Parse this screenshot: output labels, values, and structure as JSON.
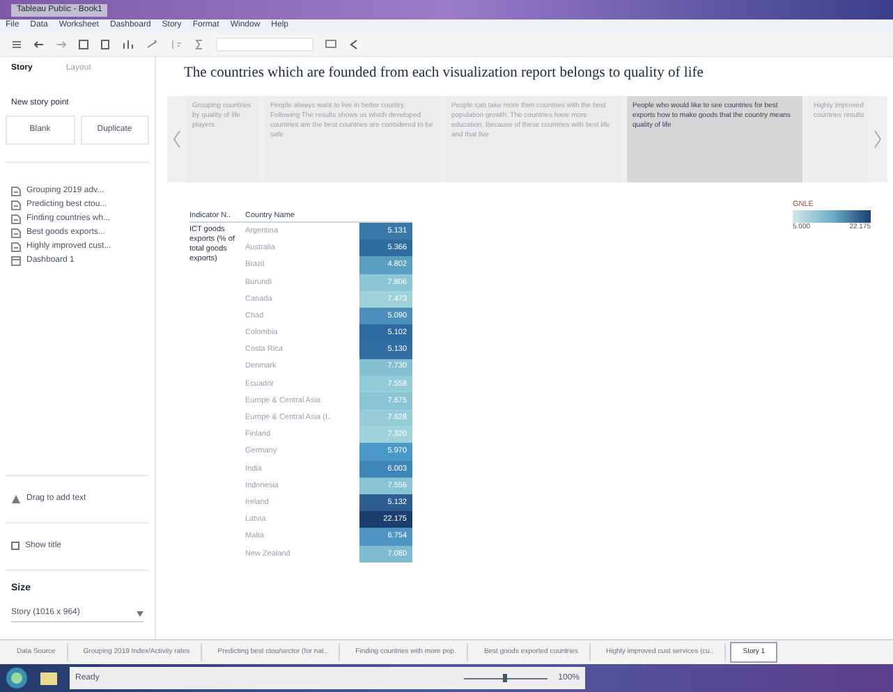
{
  "window": {
    "title": "Tableau Public - Book1"
  },
  "menu": [
    "File",
    "Data",
    "Worksheet",
    "Dashboard",
    "Story",
    "Format",
    "Window",
    "Help"
  ],
  "sidebar": {
    "tabs": [
      {
        "label": "Story",
        "selected": true
      },
      {
        "label": "Layout",
        "selected": false
      }
    ],
    "new_story_point": "New story point",
    "buttons": [
      "Blank",
      "Duplicate"
    ],
    "sheets": [
      {
        "label": "Grouping 2019 adv...",
        "kind": "sheet"
      },
      {
        "label": "Predicting best ctou...",
        "kind": "sheet"
      },
      {
        "label": "Finding countries wh...",
        "kind": "sheet"
      },
      {
        "label": "Best goods exports...",
        "kind": "sheet"
      },
      {
        "label": "Highly improved cust...",
        "kind": "sheet"
      },
      {
        "label": "Dashboard 1",
        "kind": "dashboard"
      }
    ],
    "drag_text": "Drag to add text",
    "show_title": {
      "label": "Show title",
      "checked": false
    },
    "size_label": "Size",
    "size_value": "Story (1016 x 964)"
  },
  "story": {
    "title": "The countries which are founded from each visualization report belongs to quality of life",
    "points": [
      {
        "caption": "Grouping countries by quality of life players",
        "selected": false
      },
      {
        "caption": "People always want to live in better country. Following The results shows us which developed countries are the best countries are considered to be safe",
        "selected": false
      },
      {
        "caption": "People can take more then countries with the best population growth. The countries have more education. Because of these countries with best life and that live",
        "selected": false
      },
      {
        "caption": "People who would like to see countries for best exports how to make goods that the country means quality of life",
        "selected": true
      },
      {
        "caption": "Highly improved countries results",
        "selected": false
      }
    ]
  },
  "table": {
    "columns": [
      "Indicator N..",
      "Country Name"
    ],
    "indicator": "ICT goods exports (% of total goods exports)",
    "rows": [
      {
        "country": "Argentina",
        "value": "5.131",
        "color": "#3a78a8"
      },
      {
        "country": "Australia",
        "value": "5.366",
        "color": "#2f6c9f"
      },
      {
        "country": "Brazil",
        "value": "4.802",
        "color": "#5a9fc0"
      },
      {
        "country": "Burundi",
        "value": "7.806",
        "color": "#8cc6d4"
      },
      {
        "country": "Canada",
        "value": "7.473",
        "color": "#9dd2da"
      },
      {
        "country": "Chad",
        "value": "5.090",
        "color": "#4c8fbb"
      },
      {
        "country": "Colombia",
        "value": "5.102",
        "color": "#2e6aa0"
      },
      {
        "country": "Costa Rica",
        "value": "5.130",
        "color": "#336ea2"
      },
      {
        "country": "Denmark",
        "value": "7.730",
        "color": "#84c0d2"
      },
      {
        "country": "Ecuador",
        "value": "7.558",
        "color": "#93cbd6"
      },
      {
        "country": "Europe & Central Asia",
        "value": "7.675",
        "color": "#8ac4d4"
      },
      {
        "country": "Europe & Central Asia (I..",
        "value": "7.628",
        "color": "#95ccd8"
      },
      {
        "country": "Finland",
        "value": "7.320",
        "color": "#9ed3dc"
      },
      {
        "country": "Germany",
        "value": "5.970",
        "color": "#4a98c8"
      },
      {
        "country": "India",
        "value": "6.003",
        "color": "#3f86b8"
      },
      {
        "country": "Indonesia",
        "value": "7.556",
        "color": "#88c3d4"
      },
      {
        "country": "Ireland",
        "value": "5.132",
        "color": "#2d5f92"
      },
      {
        "country": "Latvia",
        "value": "22.175",
        "color": "#1c3f70"
      },
      {
        "country": "Malta",
        "value": "6.754",
        "color": "#4f95c4"
      },
      {
        "country": "New Zealand",
        "value": "7.080",
        "color": "#7ebbd0"
      }
    ]
  },
  "legend": {
    "title": "GNLE",
    "min": "5.000",
    "max": "22.175"
  },
  "bottom_tabs": [
    {
      "label": "Data Source",
      "selected": false
    },
    {
      "label": "Grouping 2019 Index/Activity rates",
      "selected": false
    },
    {
      "label": "Predicting best ctou/sector (for nat..",
      "selected": false
    },
    {
      "label": "Finding countries with more pop.",
      "selected": false
    },
    {
      "label": "Best goods exported countries",
      "selected": false
    },
    {
      "label": "Highly improved cust services (cu..",
      "selected": false
    },
    {
      "label": "Story 1",
      "selected": true
    }
  ],
  "status": {
    "text": "Ready",
    "zoom": "100%",
    "zoom_slider": {
      "level": 0.5
    }
  }
}
